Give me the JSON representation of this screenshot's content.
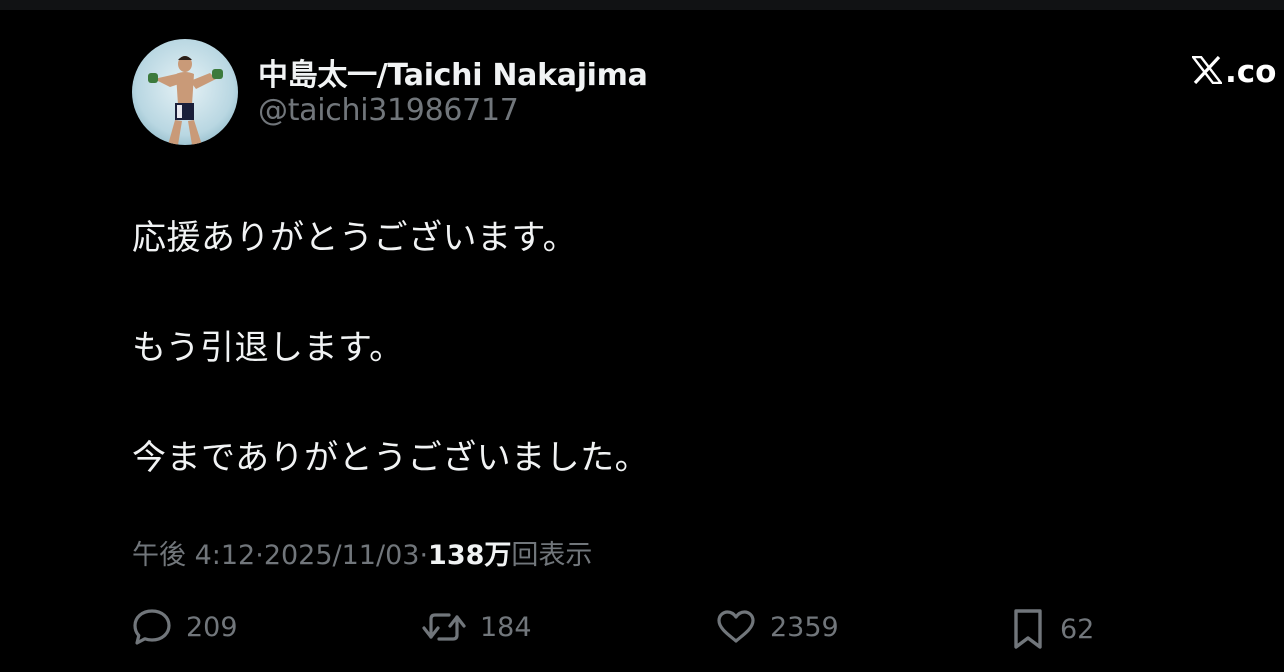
{
  "tweet": {
    "author": {
      "display_name": "中島太一/Taichi Nakajima",
      "handle": "@taichi31986717"
    },
    "brand": {
      "icon": "x-logo-icon",
      "text": ".co"
    },
    "body_lines": [
      "応援ありがとうございます。",
      "もう引退します。",
      "今までありがとうございました。"
    ],
    "meta": {
      "time": "午後 4:12",
      "separator": " · ",
      "date": "2025/11/03",
      "views_count": "138万",
      "views_label": "回表示"
    },
    "actions": {
      "reply": {
        "icon": "reply-icon",
        "count": "209"
      },
      "retweet": {
        "icon": "retweet-icon",
        "count": "184"
      },
      "like": {
        "icon": "heart-icon",
        "count": "2359"
      },
      "bookmark": {
        "icon": "bookmark-icon",
        "count": "62"
      }
    }
  },
  "colors": {
    "background": "#000000",
    "text_primary": "#f1f3f4",
    "text_secondary": "#71767b"
  }
}
